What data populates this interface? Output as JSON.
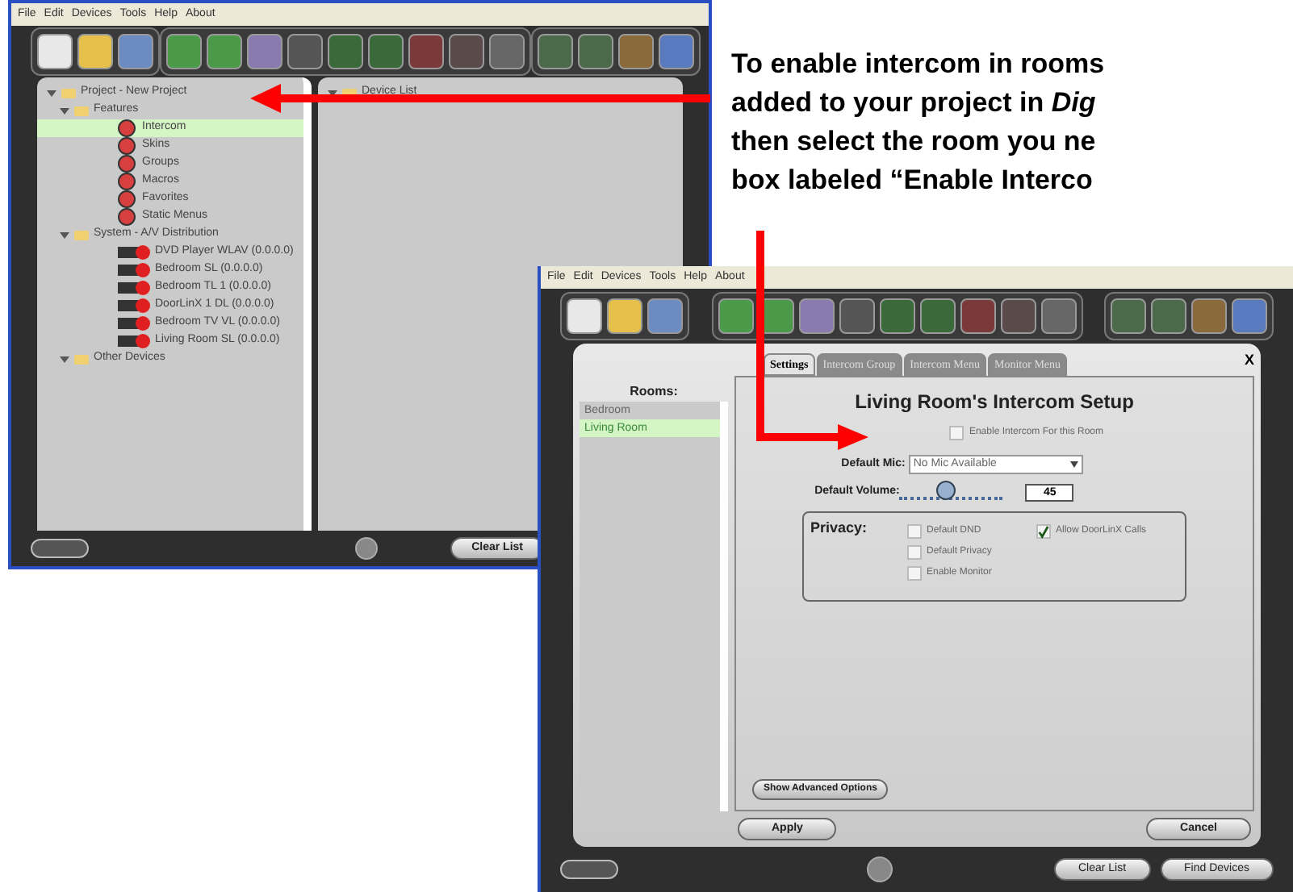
{
  "annotation": {
    "lines": [
      "To enable intercom in rooms",
      "added to your project in *Dig*",
      "then select the room you ne",
      "box labeled “Enable Interco"
    ]
  },
  "back_window": {
    "menu": [
      "File",
      "Edit",
      "Devices",
      "Tools",
      "Help",
      "About"
    ],
    "tree": [
      {
        "label": "Project - New Project",
        "kind": "folder",
        "expanded": true,
        "selected": false,
        "children": [
          {
            "label": "Features",
            "kind": "folder",
            "expanded": true,
            "selected": false,
            "children": [
              {
                "label": "Intercom",
                "kind": "feature",
                "selected": true
              },
              {
                "label": "Skins",
                "kind": "feature",
                "selected": false
              },
              {
                "label": "Groups",
                "kind": "feature",
                "selected": false
              },
              {
                "label": "Macros",
                "kind": "feature",
                "selected": false
              },
              {
                "label": "Favorites",
                "kind": "feature",
                "selected": false
              },
              {
                "label": "Static Menus",
                "kind": "feature",
                "selected": false
              }
            ]
          },
          {
            "label": "System - A/V Distribution",
            "kind": "folder",
            "expanded": true,
            "selected": false,
            "children": [
              {
                "label": "DVD Player WLAV (0.0.0.0)",
                "kind": "device",
                "selected": false
              },
              {
                "label": "Bedroom SL (0.0.0.0)",
                "kind": "device",
                "selected": false
              },
              {
                "label": "Bedroom TL 1 (0.0.0.0)",
                "kind": "device",
                "selected": false
              },
              {
                "label": "DoorLinX 1 DL (0.0.0.0)",
                "kind": "device",
                "selected": false
              },
              {
                "label": "Bedroom TV VL (0.0.0.0)",
                "kind": "device",
                "selected": false
              },
              {
                "label": "Living Room SL (0.0.0.0)",
                "kind": "device",
                "selected": false
              }
            ]
          },
          {
            "label": "Other Devices",
            "kind": "folder",
            "expanded": true,
            "selected": false
          }
        ]
      }
    ],
    "device_list": {
      "label": "Device List",
      "kind": "folder",
      "expanded": true
    },
    "footer_button": "Clear List"
  },
  "front_window": {
    "menu": [
      "File",
      "Edit",
      "Devices",
      "Tools",
      "Help",
      "About"
    ],
    "rooms_label": "Rooms:",
    "rooms": [
      {
        "label": "Bedroom",
        "selected": false
      },
      {
        "label": "Living Room",
        "selected": true
      }
    ],
    "tabs": [
      {
        "label": "Settings",
        "selected": true
      },
      {
        "label": "Intercom Group",
        "selected": false
      },
      {
        "label": "Intercom Menu",
        "selected": false
      },
      {
        "label": "Monitor Menu",
        "selected": false
      }
    ],
    "close": "X",
    "setup_title": "Living Room's Intercom Setup",
    "enable": {
      "label": "Enable Intercom For this Room",
      "checked": false
    },
    "mic": {
      "label": "Default Mic:",
      "value": "No Mic Available"
    },
    "volume": {
      "label": "Default Volume:",
      "level": 0.45,
      "value": "45"
    },
    "privacy": {
      "label": "Privacy:",
      "options": [
        {
          "label": "Default DND",
          "checked": false
        },
        {
          "label": "Allow DoorLinX Calls",
          "checked": true
        },
        {
          "label": "Default Privacy",
          "checked": false
        },
        {
          "label": "Enable Monitor",
          "checked": false
        }
      ]
    },
    "advanced_button": "Show Advanced Options",
    "apply_button": "Apply",
    "cancel_button": "Cancel",
    "footer_buttons": [
      "Clear List",
      "Find Devices"
    ]
  }
}
